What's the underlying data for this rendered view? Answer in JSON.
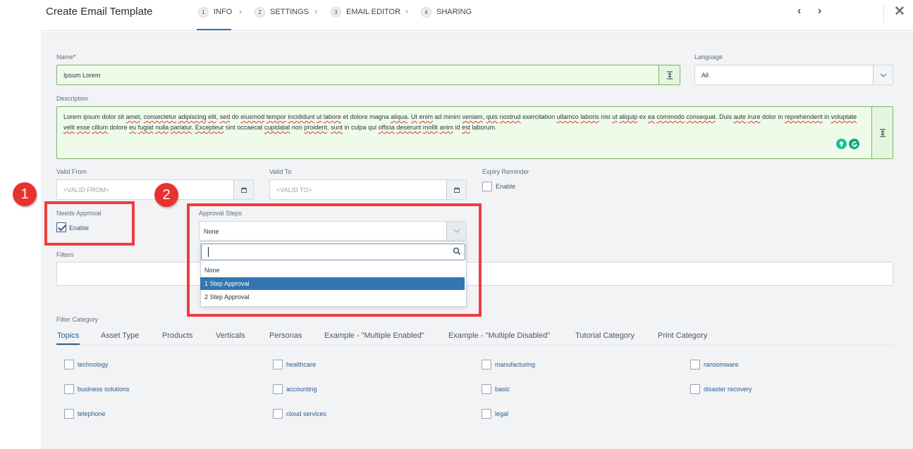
{
  "header": {
    "title": "Create Email Template",
    "steps": [
      {
        "num": "1",
        "label": "INFO"
      },
      {
        "num": "2",
        "label": "SETTINGS"
      },
      {
        "num": "3",
        "label": "EMAIL EDITOR"
      },
      {
        "num": "4",
        "label": "SHARING"
      }
    ],
    "step_arrow": "›",
    "prev_icon": "‹",
    "next_icon": "›",
    "close_icon": "✕"
  },
  "form": {
    "name_label": "Name",
    "name_required": "*",
    "name_value": "Ipsum Lorem",
    "language_label": "Language",
    "language_value": "All",
    "description_label": "Description",
    "description_parts": [
      "Lorem ipsum dolor sit ",
      "amet",
      ", ",
      "consectetur",
      " ",
      "adipiscing",
      " ",
      "elit",
      ", ",
      "sed",
      " do ",
      "eiusmod",
      " ",
      "tempor",
      " ",
      "incididunt",
      " ",
      "ut",
      " ",
      "labore",
      " et dolore magna ",
      "aliqua",
      ". ",
      "Ut",
      " ",
      "enim",
      " ad minim ",
      "veniam",
      ", ",
      "quis",
      " ",
      "nostrud",
      " exercitation ",
      "ullamco",
      " ",
      "laboris",
      " nisi ",
      "ut",
      " ",
      "aliquip",
      " ex ",
      "ea",
      " ",
      "commodo",
      " ",
      "consequat",
      ". Duis ",
      "aute",
      " ",
      "irure",
      " dolor in ",
      "reprehenderit",
      " in ",
      "voluptate",
      " ",
      "velit",
      " ",
      "esse",
      " ",
      "cillum",
      " dolore ",
      "eu",
      " ",
      "fugiat",
      " ",
      "nulla",
      " ",
      "pariatur",
      ". ",
      "Excepteur",
      " sint occaecat ",
      "cupidatat",
      " non ",
      "proident",
      ", ",
      "sunt",
      " in culpa qui ",
      "officia",
      " ",
      "deserunt",
      " ",
      "mollit",
      " ",
      "anim",
      " id ",
      "est",
      " laborum."
    ],
    "valid_from_label": "Valid From",
    "valid_from_placeholder": "<VALID FROM>",
    "valid_to_label": "Valid To",
    "valid_to_placeholder": "<VALID TO>",
    "expiry_label": "Expiry Reminder",
    "expiry_enable": "Enable",
    "needs_approval_label": "Needs Approval",
    "needs_approval_enable": "Enable",
    "needs_approval_checked": true,
    "approval_steps_label": "Approval Steps",
    "approval_steps_value": "None",
    "approval_search_value": "",
    "approval_options": [
      "None",
      "1 Step Approval",
      "2 Step Approval"
    ],
    "approval_highlighted": "1 Step Approval",
    "filters_label": "Filters",
    "filter_category_label": "Filter Category"
  },
  "annotations": {
    "badge1": "1",
    "badge2": "2",
    "color": "#ee3e3e"
  },
  "tabs": [
    "Topics",
    "Asset Type",
    "Products",
    "Verticals",
    "Personas",
    "Example - \"Multiple Enabled\"",
    "Example - \"Multiple Disabled\"",
    "Tutorial Category",
    "Print Category"
  ],
  "categories": [
    [
      "technology",
      "healthcare",
      "manufacturing",
      "ransomware"
    ],
    [
      "business solutions",
      "accounting",
      "basic",
      "disaster recovery"
    ],
    [
      "telephone",
      "cloud services",
      "legal"
    ]
  ],
  "colors": {
    "accent": "#2f5c8f",
    "selected": "#3375b0",
    "valid_field": "#eefbe9"
  }
}
